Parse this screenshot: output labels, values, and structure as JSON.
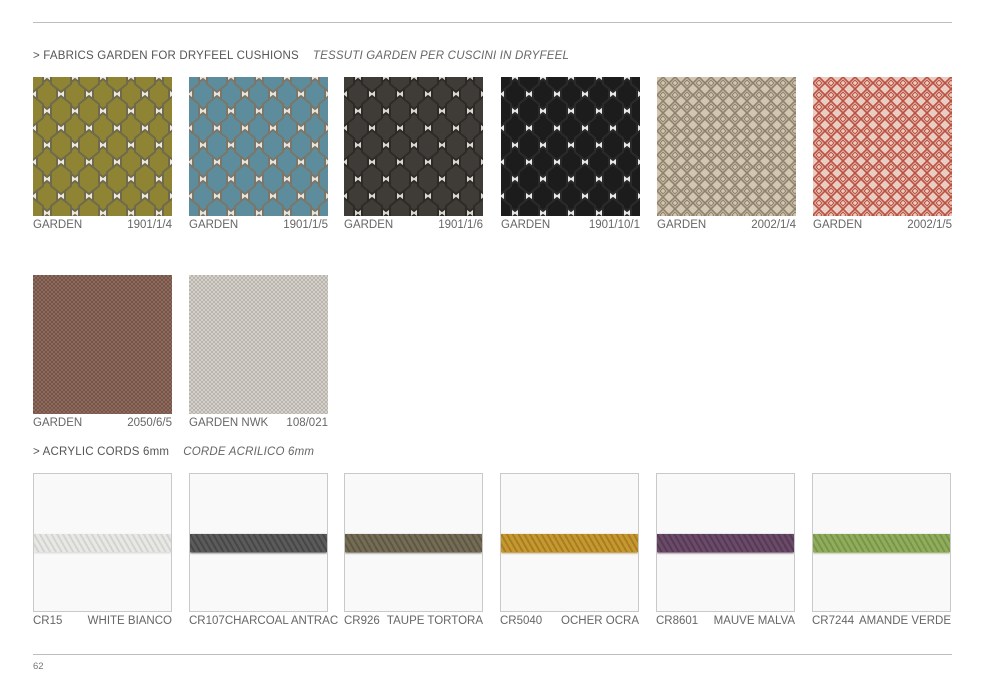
{
  "page": {
    "number": "62"
  },
  "sections": {
    "fabrics": {
      "title": "> FABRICS GARDEN FOR DRYFEEL CUSHIONS",
      "title_it": "TESSUTI GARDEN PER CUSCINI IN DRYFEEL"
    },
    "cords": {
      "title": "> ACRYLIC CORDS 6mm",
      "title_it": "CORDE ACRILICO 6mm"
    }
  },
  "fabrics": [
    {
      "name": "GARDEN",
      "code": "1901/1/4",
      "pattern": "hex",
      "bg": "#ece8dc",
      "fill": "#8e8434",
      "outline": "#6f6a4c"
    },
    {
      "name": "GARDEN",
      "code": "1901/1/5",
      "pattern": "hex",
      "bg": "#e6e4dc",
      "fill": "#5d8d9c",
      "outline": "#7a766a"
    },
    {
      "name": "GARDEN",
      "code": "1901/1/6",
      "pattern": "hex",
      "bg": "#dad7cf",
      "fill": "#3f3c38",
      "outline": "#2d2b28"
    },
    {
      "name": "GARDEN",
      "code": "1901/10/1",
      "pattern": "hex",
      "bg": "#e9e8e6",
      "fill": "#1c1c1c",
      "outline": "#2a2a2a"
    },
    {
      "name": "GARDEN",
      "code": "2002/1/4",
      "pattern": "maze",
      "bg": "#d2c6b2",
      "fill": "#8f826c"
    },
    {
      "name": "GARDEN",
      "code": "2002/1/5",
      "pattern": "maze",
      "bg": "#e9cdc2",
      "fill": "#bb5041"
    },
    {
      "name": "GARDEN",
      "code": "2050/6/5",
      "pattern": "weave",
      "bg": "#8c6a5e",
      "fill": "#765448"
    },
    {
      "name": "GARDEN NWK",
      "code": "108/021",
      "pattern": "weave",
      "bg": "#b9b4ad",
      "fill": "#d5d0c9"
    }
  ],
  "cords": [
    {
      "code": "CR15",
      "name": "WHITE BIANCO",
      "color": "#e8e8e6",
      "shade": "#d3d3d0"
    },
    {
      "code": "CR107",
      "name": "CHARCOAL ANTRAC",
      "color": "#5b5b5b",
      "shade": "#474747"
    },
    {
      "code": "CR926",
      "name": "TAUPE TORTORA",
      "color": "#756c55",
      "shade": "#5e5744"
    },
    {
      "code": "CR5040",
      "name": "OCHER OCRA",
      "color": "#c6982f",
      "shade": "#a87e22"
    },
    {
      "code": "CR8601",
      "name": "MAUVE MALVA",
      "color": "#6a4a68",
      "shade": "#553a54"
    },
    {
      "code": "CR7244",
      "name": "AMANDE VERDE",
      "color": "#8fae5b",
      "shade": "#7a9549"
    }
  ]
}
